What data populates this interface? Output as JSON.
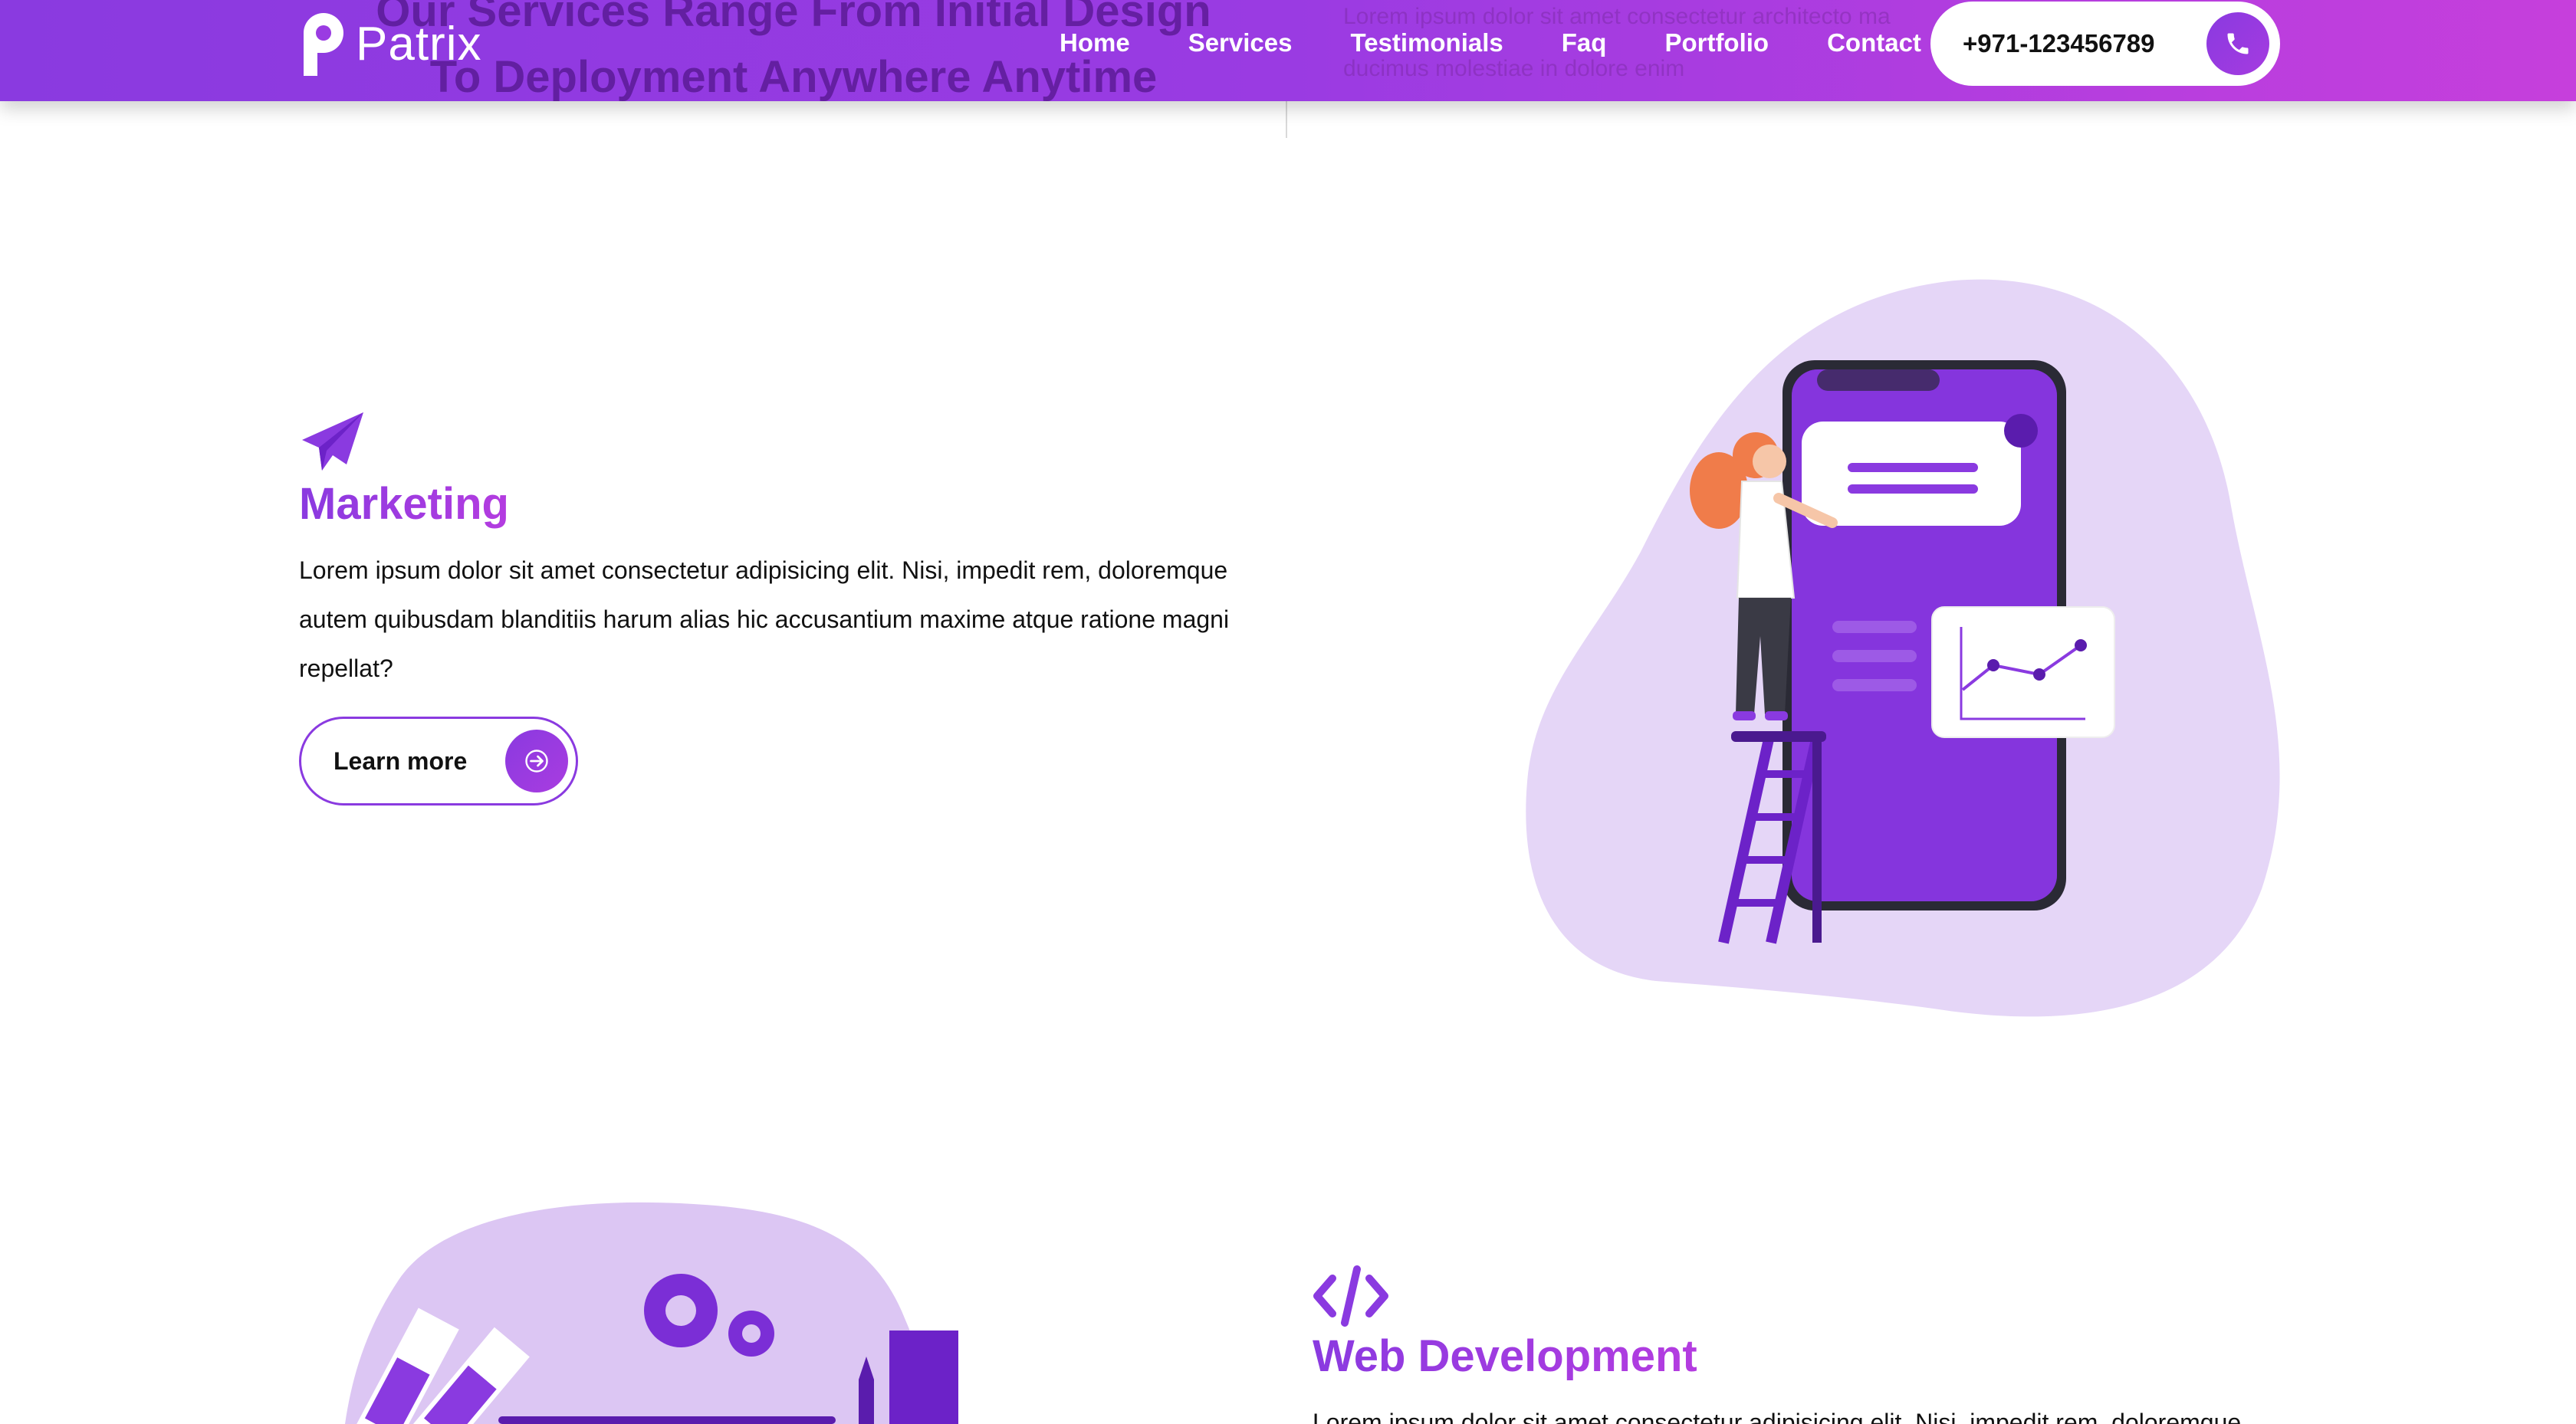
{
  "header": {
    "logo_text": "Patrix",
    "nav": [
      "Home",
      "Services",
      "Testimonials",
      "Faq",
      "Portfolio",
      "Contact"
    ],
    "phone": "+971-123456789",
    "colors": {
      "gradient_start": "#8a3ae0",
      "gradient_end": "#c63fdc"
    }
  },
  "behind_header": {
    "heading_line1": "Our Services Range From Initial Design",
    "heading_line2": "To Deployment Anywhere Anytime",
    "para_line1": "Lorem ipsum dolor sit amet consectetur architecto ma",
    "para_line2": "ducimus molestiae in dolore enim"
  },
  "services": [
    {
      "icon": "paper-plane-icon",
      "title": "Marketing",
      "description": "Lorem ipsum dolor sit amet consectetur adipisicing elit. Nisi, impedit rem, doloremque autem quibusdam blanditiis harum alias hic accusantium maxime atque ratione magni repellat?",
      "button_label": "Learn more"
    },
    {
      "icon": "code-icon",
      "title": "Web Development",
      "description": "Lorem ipsum dolor sit amet consectetur adipisicing elit. Nisi, impedit rem, doloremque"
    }
  ],
  "accent_color": "#8a3ae0"
}
